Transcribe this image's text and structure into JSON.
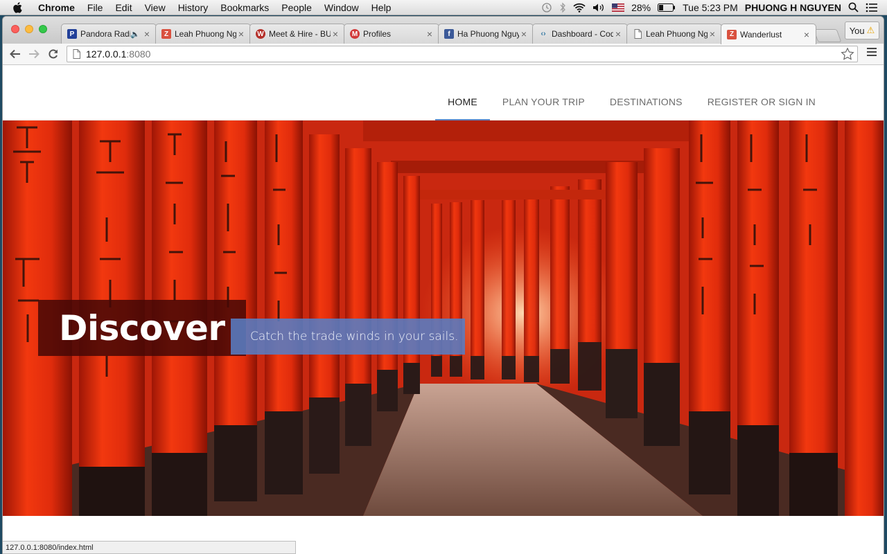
{
  "menubar": {
    "app_name": "Chrome",
    "items": [
      "File",
      "Edit",
      "View",
      "History",
      "Bookmarks",
      "People",
      "Window",
      "Help"
    ],
    "battery": "28%",
    "clock": "Tue 5:23 PM",
    "user": "PHUONG H NGUYEN"
  },
  "browser": {
    "tabs": [
      {
        "title": "Pandora Radio",
        "favicon": "P",
        "favicon_color": "#224099",
        "audio": true
      },
      {
        "title": "Leah Phuong Nguyen",
        "favicon": "Z",
        "favicon_color": "#d9513f"
      },
      {
        "title": "Meet & Hire - BUNCH",
        "favicon": "W",
        "favicon_color": "#b5302a"
      },
      {
        "title": "Profiles",
        "favicon": "M",
        "favicon_color": "#d23a3a"
      },
      {
        "title": "Ha Phuong Nguyen",
        "favicon": "f",
        "favicon_color": "#3b5998"
      },
      {
        "title": "Dashboard - Codecademy",
        "favicon": "<>",
        "favicon_color": "#3d7ea6"
      },
      {
        "title": "Leah Phuong Nguyen",
        "favicon": "doc",
        "favicon_color": "#888888"
      },
      {
        "title": "Wanderlust",
        "favicon": "Z",
        "favicon_color": "#d9513f",
        "active": true
      }
    ],
    "profile_label": "You",
    "url_host": "127.0.0.1",
    "url_port": ":8080",
    "status_url": "127.0.0.1:8080/index.html"
  },
  "site": {
    "nav": [
      "HOME",
      "PLAN YOUR TRIP",
      "DESTINATIONS",
      "REGISTER OR SIGN IN"
    ],
    "active_nav": "HOME",
    "hero": {
      "headline": "Discover",
      "subhead": "Catch the trade winds in your sails."
    }
  },
  "colors": {
    "accent": "#5b86c5",
    "torii_red": "#e8300f",
    "discover_bg": "#460806",
    "subhead_bg": "#587dc4"
  }
}
